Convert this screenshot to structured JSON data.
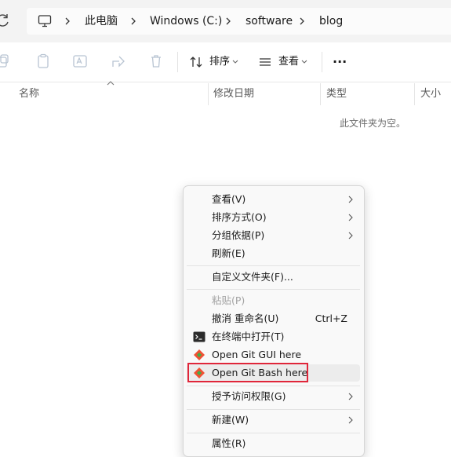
{
  "address_bar": {
    "segments": [
      "此电脑",
      "Windows (C:)",
      "software",
      "blog"
    ]
  },
  "toolbar": {
    "sort_label": "排序",
    "view_label": "查看",
    "more_label": "···"
  },
  "columns": {
    "name": "名称",
    "modified": "修改日期",
    "type": "类型",
    "size": "大小"
  },
  "empty_message": "此文件夹为空。",
  "context_menu": {
    "items": [
      {
        "label": "查看(V)",
        "submenu": true
      },
      {
        "label": "排序方式(O)",
        "submenu": true
      },
      {
        "label": "分组依据(P)",
        "submenu": true
      },
      {
        "label": "刷新(E)"
      },
      {
        "label": "自定义文件夹(F)..."
      },
      {
        "label": "粘贴(P)",
        "disabled": true
      },
      {
        "label": "撤消 重命名(U)",
        "shortcut": "Ctrl+Z"
      },
      {
        "label": "在终端中打开(T)",
        "icon": "terminal-icon"
      },
      {
        "label": "Open Git GUI here",
        "icon": "git-icon"
      },
      {
        "label": "Open Git Bash here",
        "icon": "git-icon",
        "highlighted": true
      },
      {
        "label": "授予访问权限(G)",
        "submenu": true
      },
      {
        "label": "新建(W)",
        "submenu": true
      },
      {
        "label": "属性(R)"
      }
    ]
  },
  "colors": {
    "highlight_box": "#e0263a",
    "git_orange": "#f05133",
    "git_green": "#3fae49"
  }
}
